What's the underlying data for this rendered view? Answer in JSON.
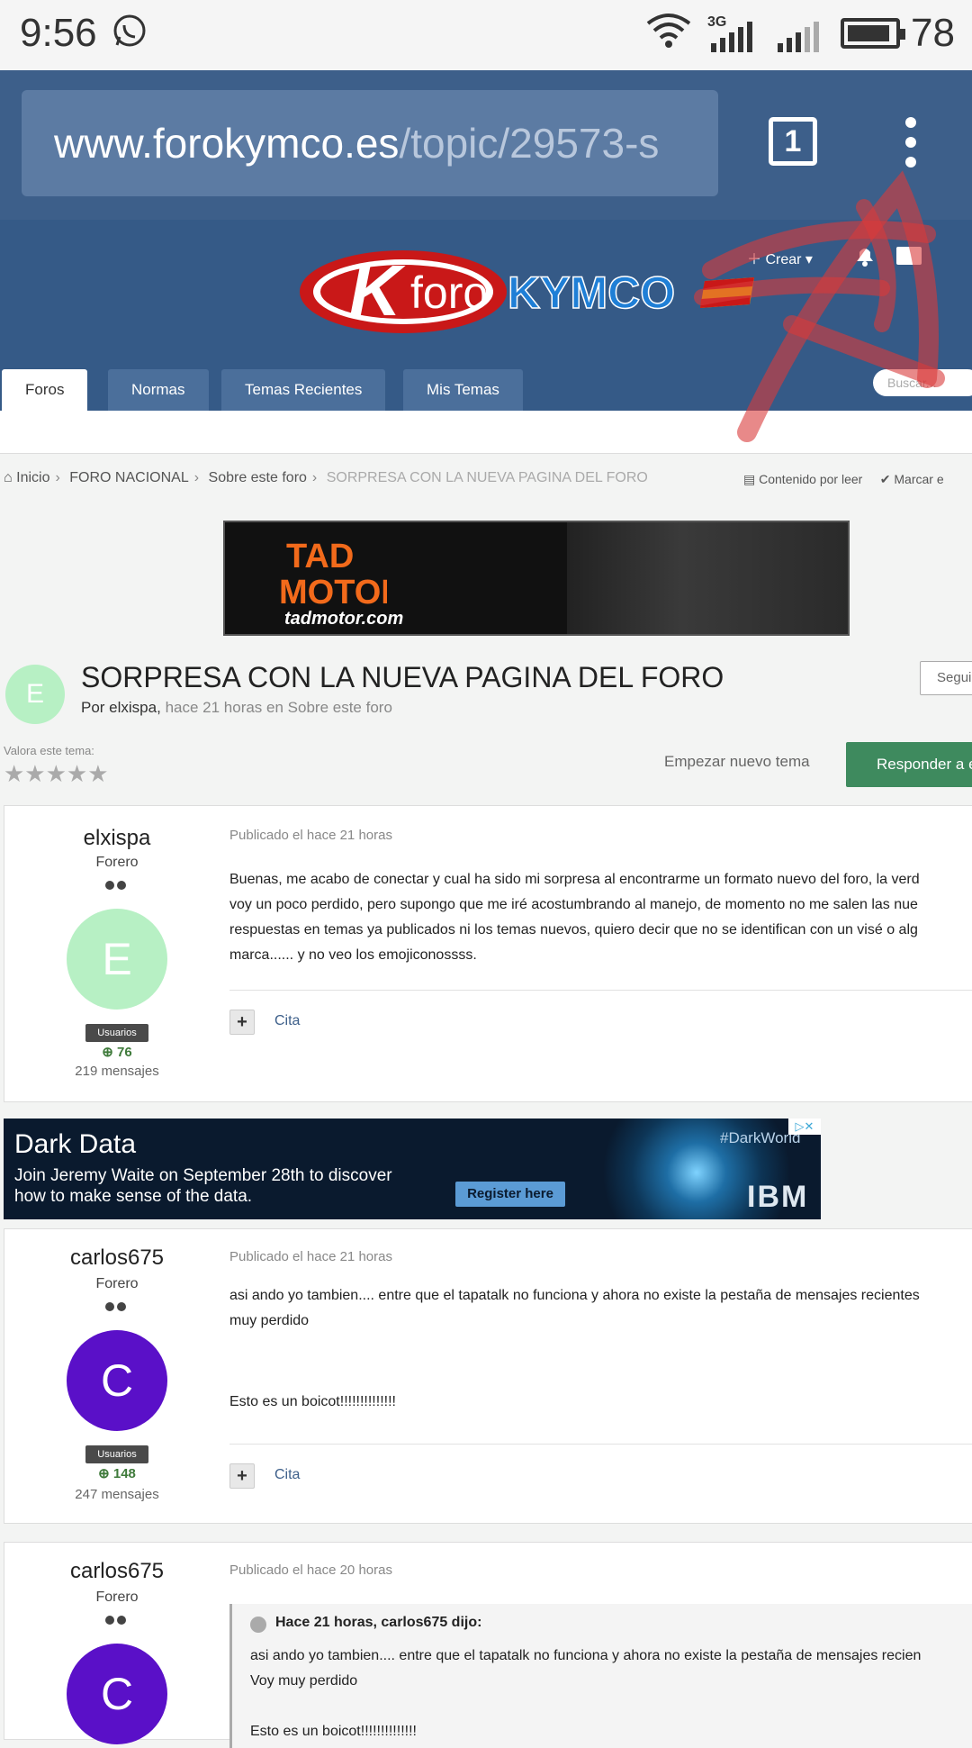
{
  "status": {
    "time": "9:56",
    "network": "3G",
    "battery": "78"
  },
  "browser": {
    "url_host": "www.forokymco.es",
    "url_path": "/topic/29573-s",
    "tab_count": "1"
  },
  "site": {
    "logo_text_a": "foro",
    "logo_text_b": "KYMCO",
    "crear": "Crear",
    "search_placeholder": "Buscar..."
  },
  "nav": {
    "tabs": [
      "Foros",
      "Normas",
      "Temas Recientes",
      "Mis Temas"
    ]
  },
  "breadcrumb": {
    "items": [
      "Inicio",
      "FORO NACIONAL",
      "Sobre este foro",
      "SORPRESA CON LA NUEVA PAGINA DEL FORO"
    ],
    "unread": "Contenido por leer",
    "mark": "Marcar e"
  },
  "ad_top": {
    "brand": "tadmotor.com"
  },
  "topic": {
    "avatar_letter": "E",
    "title": "SORPRESA CON LA NUEVA PAGINA DEL FORO",
    "by": "Por elxispa,",
    "when": "hace 21 horas en Sobre este foro",
    "follow": "Seguir",
    "rate_label": "Valora este tema:",
    "stars": "★★★★★",
    "new_topic": "Empezar nuevo tema",
    "reply": "Responder a e"
  },
  "posts": [
    {
      "username": "elxispa",
      "role": "Forero",
      "avatar_letter": "E",
      "avatar_color": "#b7f0c4",
      "group": "Usuarios",
      "rep": "76",
      "count": "219 mensajes",
      "date": "Publicado el hace 21 horas",
      "lines": [
        "Buenas, me acabo de conectar y cual ha sido mi sorpresa al encontrarme un formato nuevo del foro, la verd",
        "voy un poco perdido, pero supongo que me iré acostumbrando al manejo, de momento no me salen las nue",
        "respuestas en temas ya publicados ni los temas nuevos, quiero decir que no se identifican con un visé o alg",
        "marca...... y no veo los emojiconossss."
      ],
      "quote_label": "Cita"
    },
    {
      "username": "carlos675",
      "role": "Forero",
      "avatar_letter": "C",
      "avatar_color": "#5a10c8",
      "group": "Usuarios",
      "rep": "148",
      "count": "247 mensajes",
      "date": "Publicado el hace 21 horas",
      "lines": [
        "asi ando yo tambien.... entre que el tapatalk no funciona y ahora no existe la pestaña de mensajes recientes",
        "muy perdido",
        "",
        "",
        "Esto es un boicot!!!!!!!!!!!!!!"
      ],
      "quote_label": "Cita"
    },
    {
      "username": "carlos675",
      "role": "Forero",
      "avatar_letter": "C",
      "avatar_color": "#5a10c8",
      "date": "Publicado el hace 20 horas",
      "quote_head": "Hace 21 horas, carlos675 dijo:",
      "quote_lines": [
        "asi ando yo tambien.... entre que el tapatalk no funciona y ahora no existe la pestaña de mensajes recien",
        "Voy muy perdido",
        "",
        "Esto es un boicot!!!!!!!!!!!!!!"
      ]
    }
  ],
  "ad_ibm": {
    "headline": "Dark Data",
    "line1": "Join Jeremy Waite on September 28th to discover",
    "line2": "how to make sense of the data.",
    "cta": "Register here",
    "tag": "#DarkWorld",
    "brand": "IBM"
  },
  "colors": {
    "header": "#355a87",
    "urlbar": "#3d5f8a",
    "reply_button": "#3e8a5e",
    "annotation": "#d93a3a"
  }
}
